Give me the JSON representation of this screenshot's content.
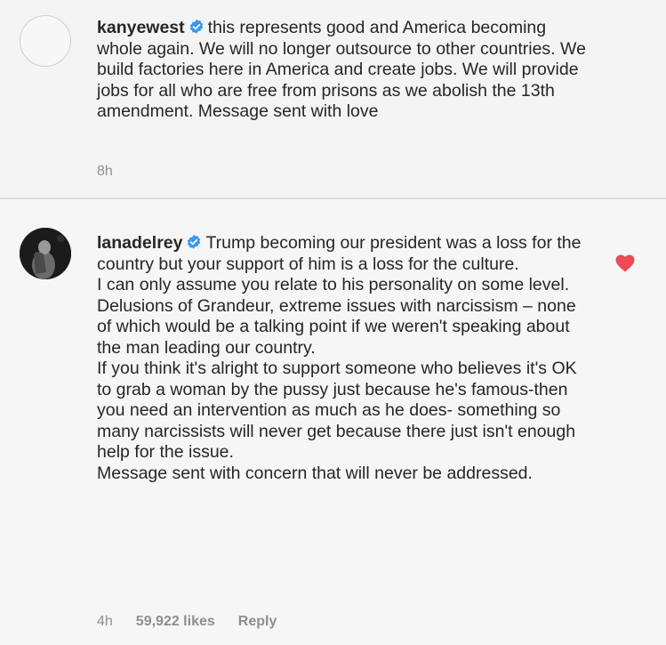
{
  "comments": [
    {
      "username": "kanyewest",
      "verified": true,
      "paragraphs": [
        "this represents good and America becoming whole again.  We will no longer outsource to other countries. We build factories here in America and create jobs.  We will provide jobs for all who are free from prisons as we abolish the 13th amendment. Message sent with love"
      ],
      "time": "8h"
    },
    {
      "username": "lanadelrey",
      "verified": true,
      "paragraphs": [
        "Trump becoming our president was a loss for the country but your support of him is a loss for the culture.",
        "I can only assume you relate to his personality on some level. Delusions of Grandeur, extreme issues with narcissism – none of which would be a talking point if we weren't speaking about the man leading our country.",
        "If you think it's alright to support someone who believes it's OK to grab a woman by the pussy just because he's famous-then you need an intervention as much as he does- something so many narcissists will never get because there just isn't enough help for the issue.",
        "Message sent with concern that will never be addressed."
      ],
      "time": "4h",
      "likes": "59,922 likes",
      "reply_label": "Reply",
      "liked": true
    }
  ],
  "colors": {
    "verified": "#3897f0",
    "heart": "#ed4956",
    "meta": "#8e8e8e"
  },
  "icons": {
    "verified": "verified-badge-icon",
    "like": "heart-icon"
  }
}
